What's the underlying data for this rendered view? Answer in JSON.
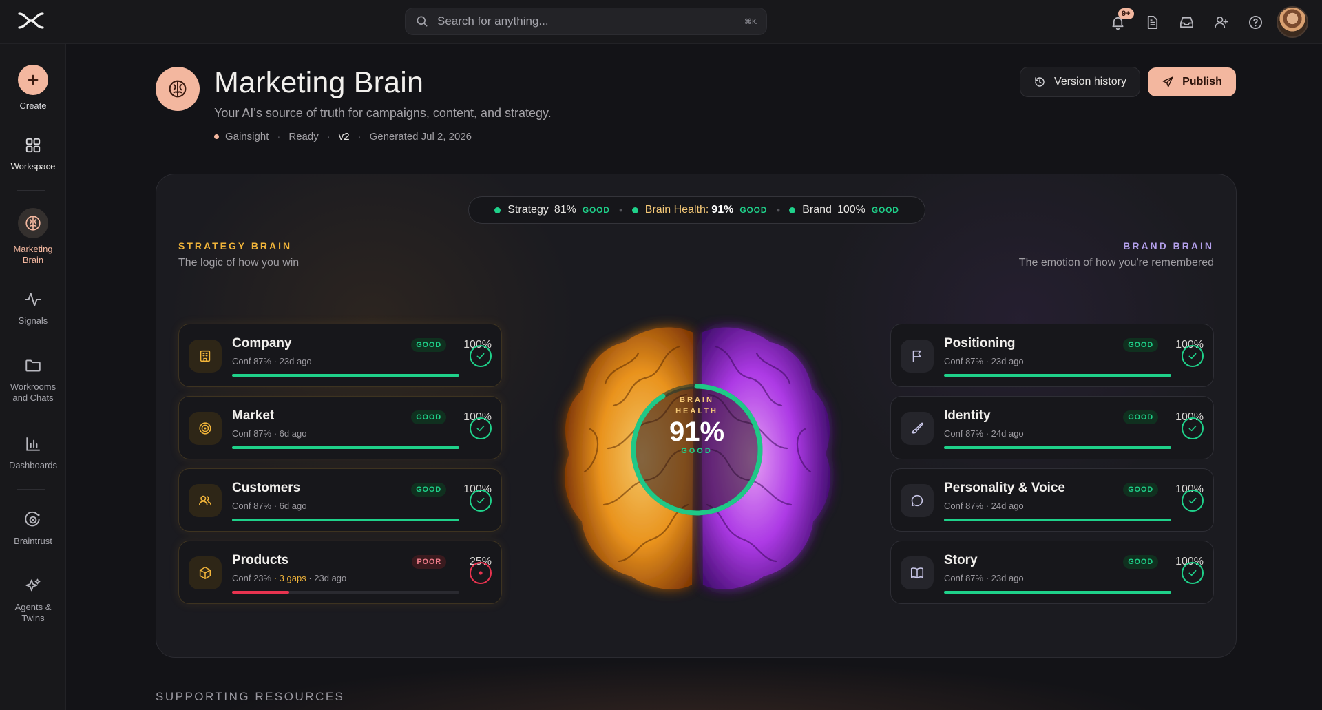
{
  "search": {
    "placeholder": "Search for anything...",
    "shortcut": "⌘K"
  },
  "topbar": {
    "notification_count": "9+"
  },
  "sidebar": {
    "create_label": "Create",
    "items": [
      {
        "label": "Workspace",
        "icon": "grid-icon"
      },
      {
        "label": "Marketing Brain",
        "icon": "brain-icon",
        "active": true
      },
      {
        "label": "Signals",
        "icon": "activity-icon"
      },
      {
        "label": "Workrooms and Chats",
        "icon": "folder-icon"
      },
      {
        "label": "Dashboards",
        "icon": "bar-chart-icon"
      },
      {
        "label": "Braintrust",
        "icon": "braintrust-icon"
      },
      {
        "label": "Agents & Twins",
        "icon": "sparkles-icon"
      }
    ]
  },
  "header": {
    "title": "Marketing Brain",
    "subtitle": "Your AI's source of truth for campaigns, content, and strategy.",
    "meta": {
      "org": "Gainsight",
      "status": "Ready",
      "version": "v2",
      "generated": "Generated Jul 2, 2026"
    },
    "version_history_label": "Version history",
    "publish_label": "Publish"
  },
  "summary": {
    "strategy_label": "Strategy",
    "strategy_pct": "81%",
    "strategy_status": "GOOD",
    "health_label": "Brain Health:",
    "health_pct": "91%",
    "health_status": "GOOD",
    "brand_label": "Brand",
    "brand_pct": "100%",
    "brand_status": "GOOD"
  },
  "strategy_brain": {
    "title": "STRATEGY BRAIN",
    "subtitle": "The logic of how you win",
    "cards": [
      {
        "name": "Company",
        "status": "GOOD",
        "pct": "100%",
        "conf": "Conf 87%",
        "gaps": "",
        "age": "· 23d ago",
        "progress": 100,
        "icon": "building-icon"
      },
      {
        "name": "Market",
        "status": "GOOD",
        "pct": "100%",
        "conf": "Conf 87%",
        "gaps": "",
        "age": "· 6d ago",
        "progress": 100,
        "icon": "target-icon"
      },
      {
        "name": "Customers",
        "status": "GOOD",
        "pct": "100%",
        "conf": "Conf 87%",
        "gaps": "",
        "age": "· 6d ago",
        "progress": 100,
        "icon": "users-icon"
      },
      {
        "name": "Products",
        "status": "POOR",
        "pct": "25%",
        "conf": "Conf 23%",
        "gaps": "· 3 gaps",
        "age": "· 23d ago",
        "progress": 25,
        "icon": "box-icon"
      }
    ]
  },
  "brand_brain": {
    "title": "BRAND BRAIN",
    "subtitle": "The emotion of how you're remembered",
    "cards": [
      {
        "name": "Positioning",
        "status": "GOOD",
        "pct": "100%",
        "conf": "Conf 87%",
        "age": "· 23d ago",
        "progress": 100,
        "icon": "flag-icon"
      },
      {
        "name": "Identity",
        "status": "GOOD",
        "pct": "100%",
        "conf": "Conf 87%",
        "age": "· 24d ago",
        "progress": 100,
        "icon": "brush-icon"
      },
      {
        "name": "Personality & Voice",
        "status": "GOOD",
        "pct": "100%",
        "conf": "Conf 87%",
        "age": "· 24d ago",
        "progress": 100,
        "icon": "chat-bubble-icon"
      },
      {
        "name": "Story",
        "status": "GOOD",
        "pct": "100%",
        "conf": "Conf 87%",
        "age": "· 23d ago",
        "progress": 100,
        "icon": "book-icon"
      }
    ]
  },
  "gauge": {
    "label_line1": "BRAIN",
    "label_line2": "HEALTH",
    "value": "91%",
    "status": "GOOD",
    "progress": 91
  },
  "supporting_title": "SUPPORTING RESOURCES",
  "colors": {
    "accent": "#f3b79f",
    "good": "#1fd18a",
    "poor": "#e8334f",
    "strategy": "#f2b53a",
    "brand": "#b4a0ec"
  }
}
